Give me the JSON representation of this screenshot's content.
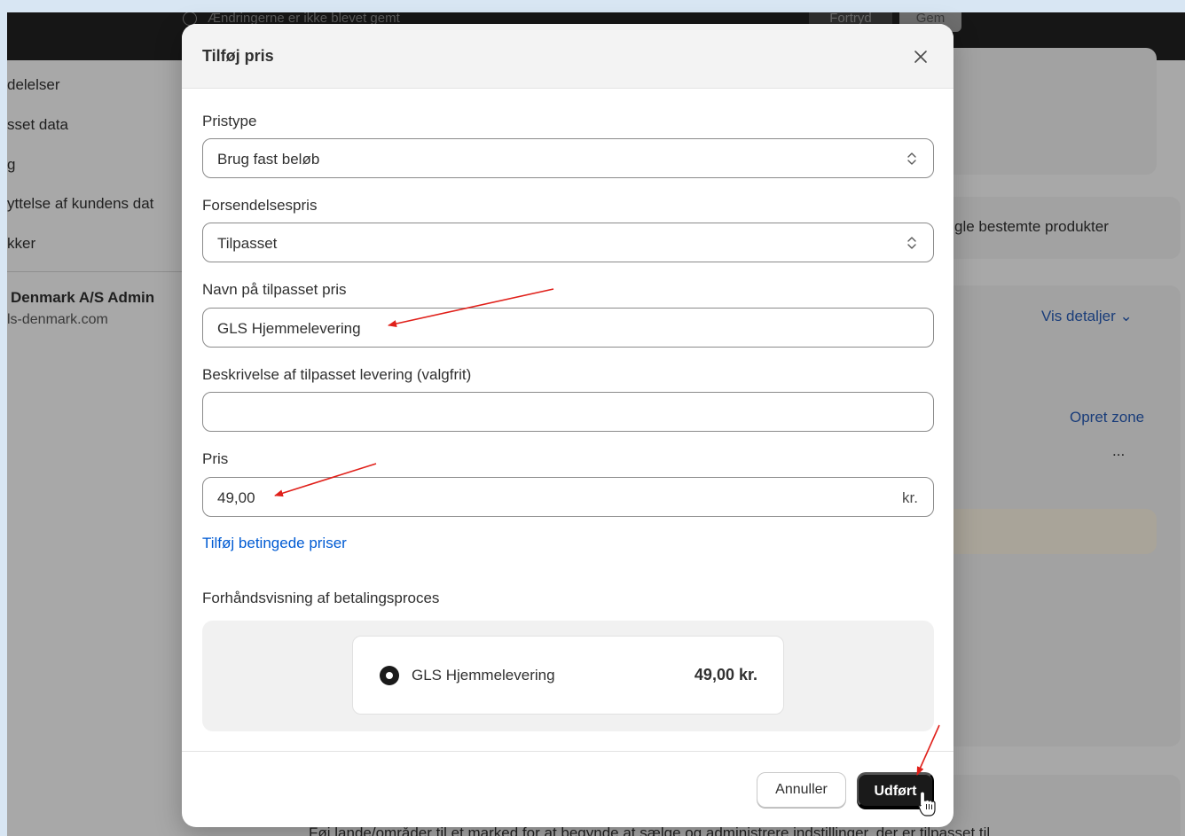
{
  "topbar": {
    "unsaved_text": "Ændringerne er ikke blevet gemt",
    "discard_label": "Fortryd",
    "save_label": "Gem"
  },
  "sidebar": {
    "items": [
      {
        "label": "delelser"
      },
      {
        "label": "sset data"
      },
      {
        "label": "g"
      },
      {
        "label": "yttelse af kundens dat"
      },
      {
        "label": "kker"
      }
    ],
    "store_name": "Denmark A/S Admin",
    "store_url": "ls-denmark.com"
  },
  "background": {
    "products_text": "gle bestemte produkter",
    "details_link": "Vis detaljer",
    "create_zone_link": "Opret zone",
    "more_label": "...",
    "bottom_text": "Føj lande/områder til et marked for at begynde at sælge og administrere indstillinger, der er tilpasset til"
  },
  "modal": {
    "title": "Tilføj pris",
    "price_type": {
      "label": "Pristype",
      "value": "Brug fast beløb"
    },
    "shipping_rate": {
      "label": "Forsendelsespris",
      "value": "Tilpasset"
    },
    "custom_name": {
      "label": "Navn på tilpasset pris",
      "value": "GLS Hjemmelevering"
    },
    "description": {
      "label": "Beskrivelse af tilpasset levering (valgfrit)",
      "value": ""
    },
    "price": {
      "label": "Pris",
      "value": "49,00",
      "suffix": "kr."
    },
    "conditional_link": "Tilføj betingede priser",
    "preview": {
      "label": "Forhåndsvisning af betalingsproces",
      "name": "GLS Hjemmelevering",
      "price": "49,00 kr."
    },
    "cancel_label": "Annuller",
    "done_label": "Udført"
  },
  "colors": {
    "accent_link": "#005bd3",
    "primary_button": "#1a1a1a",
    "annotation_arrow": "#e0201a",
    "page_background": "#d8e6f3"
  }
}
